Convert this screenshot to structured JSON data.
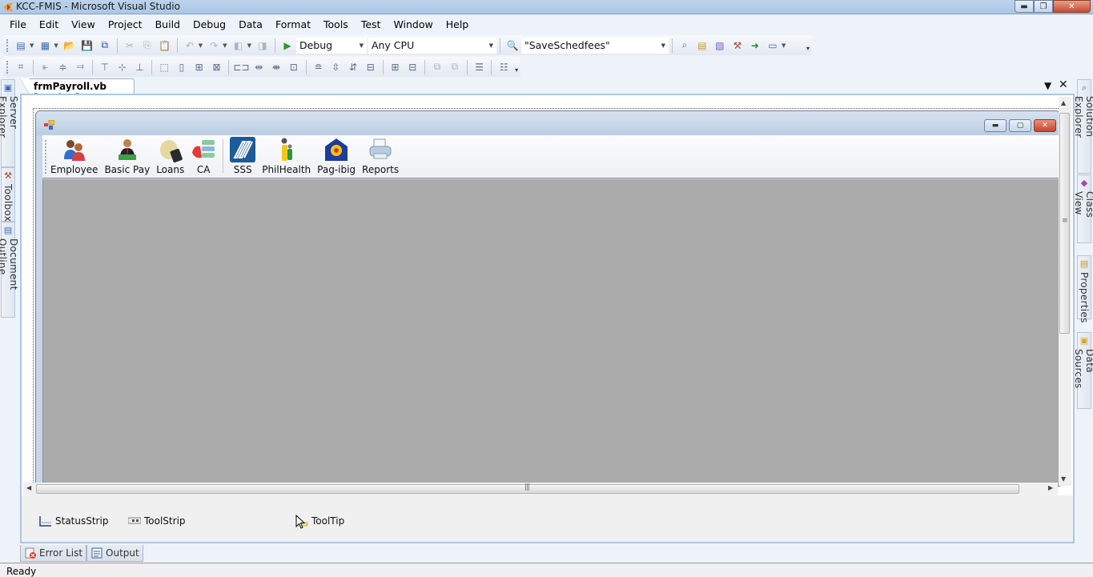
{
  "window": {
    "title": "KCC-FMIS - Microsoft Visual Studio",
    "controls": {
      "minimize": "minimize",
      "restore": "restore",
      "close": "close"
    }
  },
  "menu": [
    "File",
    "Edit",
    "View",
    "Project",
    "Build",
    "Debug",
    "Data",
    "Format",
    "Tools",
    "Test",
    "Window",
    "Help"
  ],
  "standard_toolbar": {
    "icons": [
      "new-project-icon",
      "add-item-icon",
      "open-file-icon",
      "save-icon",
      "save-all-icon",
      "cut-icon",
      "copy-icon",
      "paste-icon",
      "undo-icon",
      "redo-icon",
      "navigate-backward-icon",
      "navigate-forward-icon",
      "start-debugging-icon"
    ],
    "configuration": "Debug",
    "platform": "Any CPU",
    "find_icon": "find-in-files-icon",
    "find_text": "\"SaveSchedfees\"",
    "window_icons": [
      "solution-explorer-icon",
      "properties-window-icon",
      "object-browser-icon",
      "toolbox-icon",
      "start-page-icon",
      "command-window-icon"
    ]
  },
  "layout_toolbar": {
    "icons": [
      "align-to-grid-icon",
      "align-lefts-icon",
      "align-centers-icon",
      "align-rights-icon",
      "align-tops-icon",
      "align-middles-icon",
      "align-bottoms-icon",
      "make-same-width-icon",
      "make-same-height-icon",
      "make-same-size-icon",
      "size-to-grid-icon",
      "make-horizontal-spacing-equal-icon",
      "increase-horizontal-spacing-icon",
      "decrease-horizontal-spacing-icon",
      "remove-horizontal-spacing-icon",
      "make-vertical-spacing-equal-icon",
      "increase-vertical-spacing-icon",
      "decrease-vertical-spacing-icon",
      "remove-vertical-spacing-icon",
      "center-horizontally-icon",
      "center-vertically-icon",
      "bring-to-front-icon",
      "send-to-back-icon",
      "tab-order-icon",
      "lock-controls-icon"
    ]
  },
  "left_side_tabs": [
    "Server Explorer",
    "Toolbox",
    "Document Outline"
  ],
  "right_side_tabs": [
    "Solution Explorer",
    "Class View",
    "Properties",
    "Data Sources"
  ],
  "document": {
    "tab_label": "frmPayroll.vb [Design]",
    "form_toolstrip": [
      {
        "label": "Employee",
        "icon": "employee-icon"
      },
      {
        "label": "Basic Pay",
        "icon": "basic-pay-icon"
      },
      {
        "label": "Loans",
        "icon": "loans-icon"
      },
      {
        "label": "CA",
        "icon": "cash-advance-icon"
      },
      {
        "label": "SSS",
        "icon": "sss-logo-icon"
      },
      {
        "label": "PhilHealth",
        "icon": "philhealth-logo-icon"
      },
      {
        "label": "Pag-ibig",
        "icon": "pag-ibig-logo-icon"
      },
      {
        "label": "Reports",
        "icon": "printer-icon"
      }
    ],
    "component_tray": [
      "StatusStrip",
      "ToolStrip",
      "ToolTip"
    ]
  },
  "bottom_tabs": [
    "Error List",
    "Output"
  ],
  "status": "Ready"
}
